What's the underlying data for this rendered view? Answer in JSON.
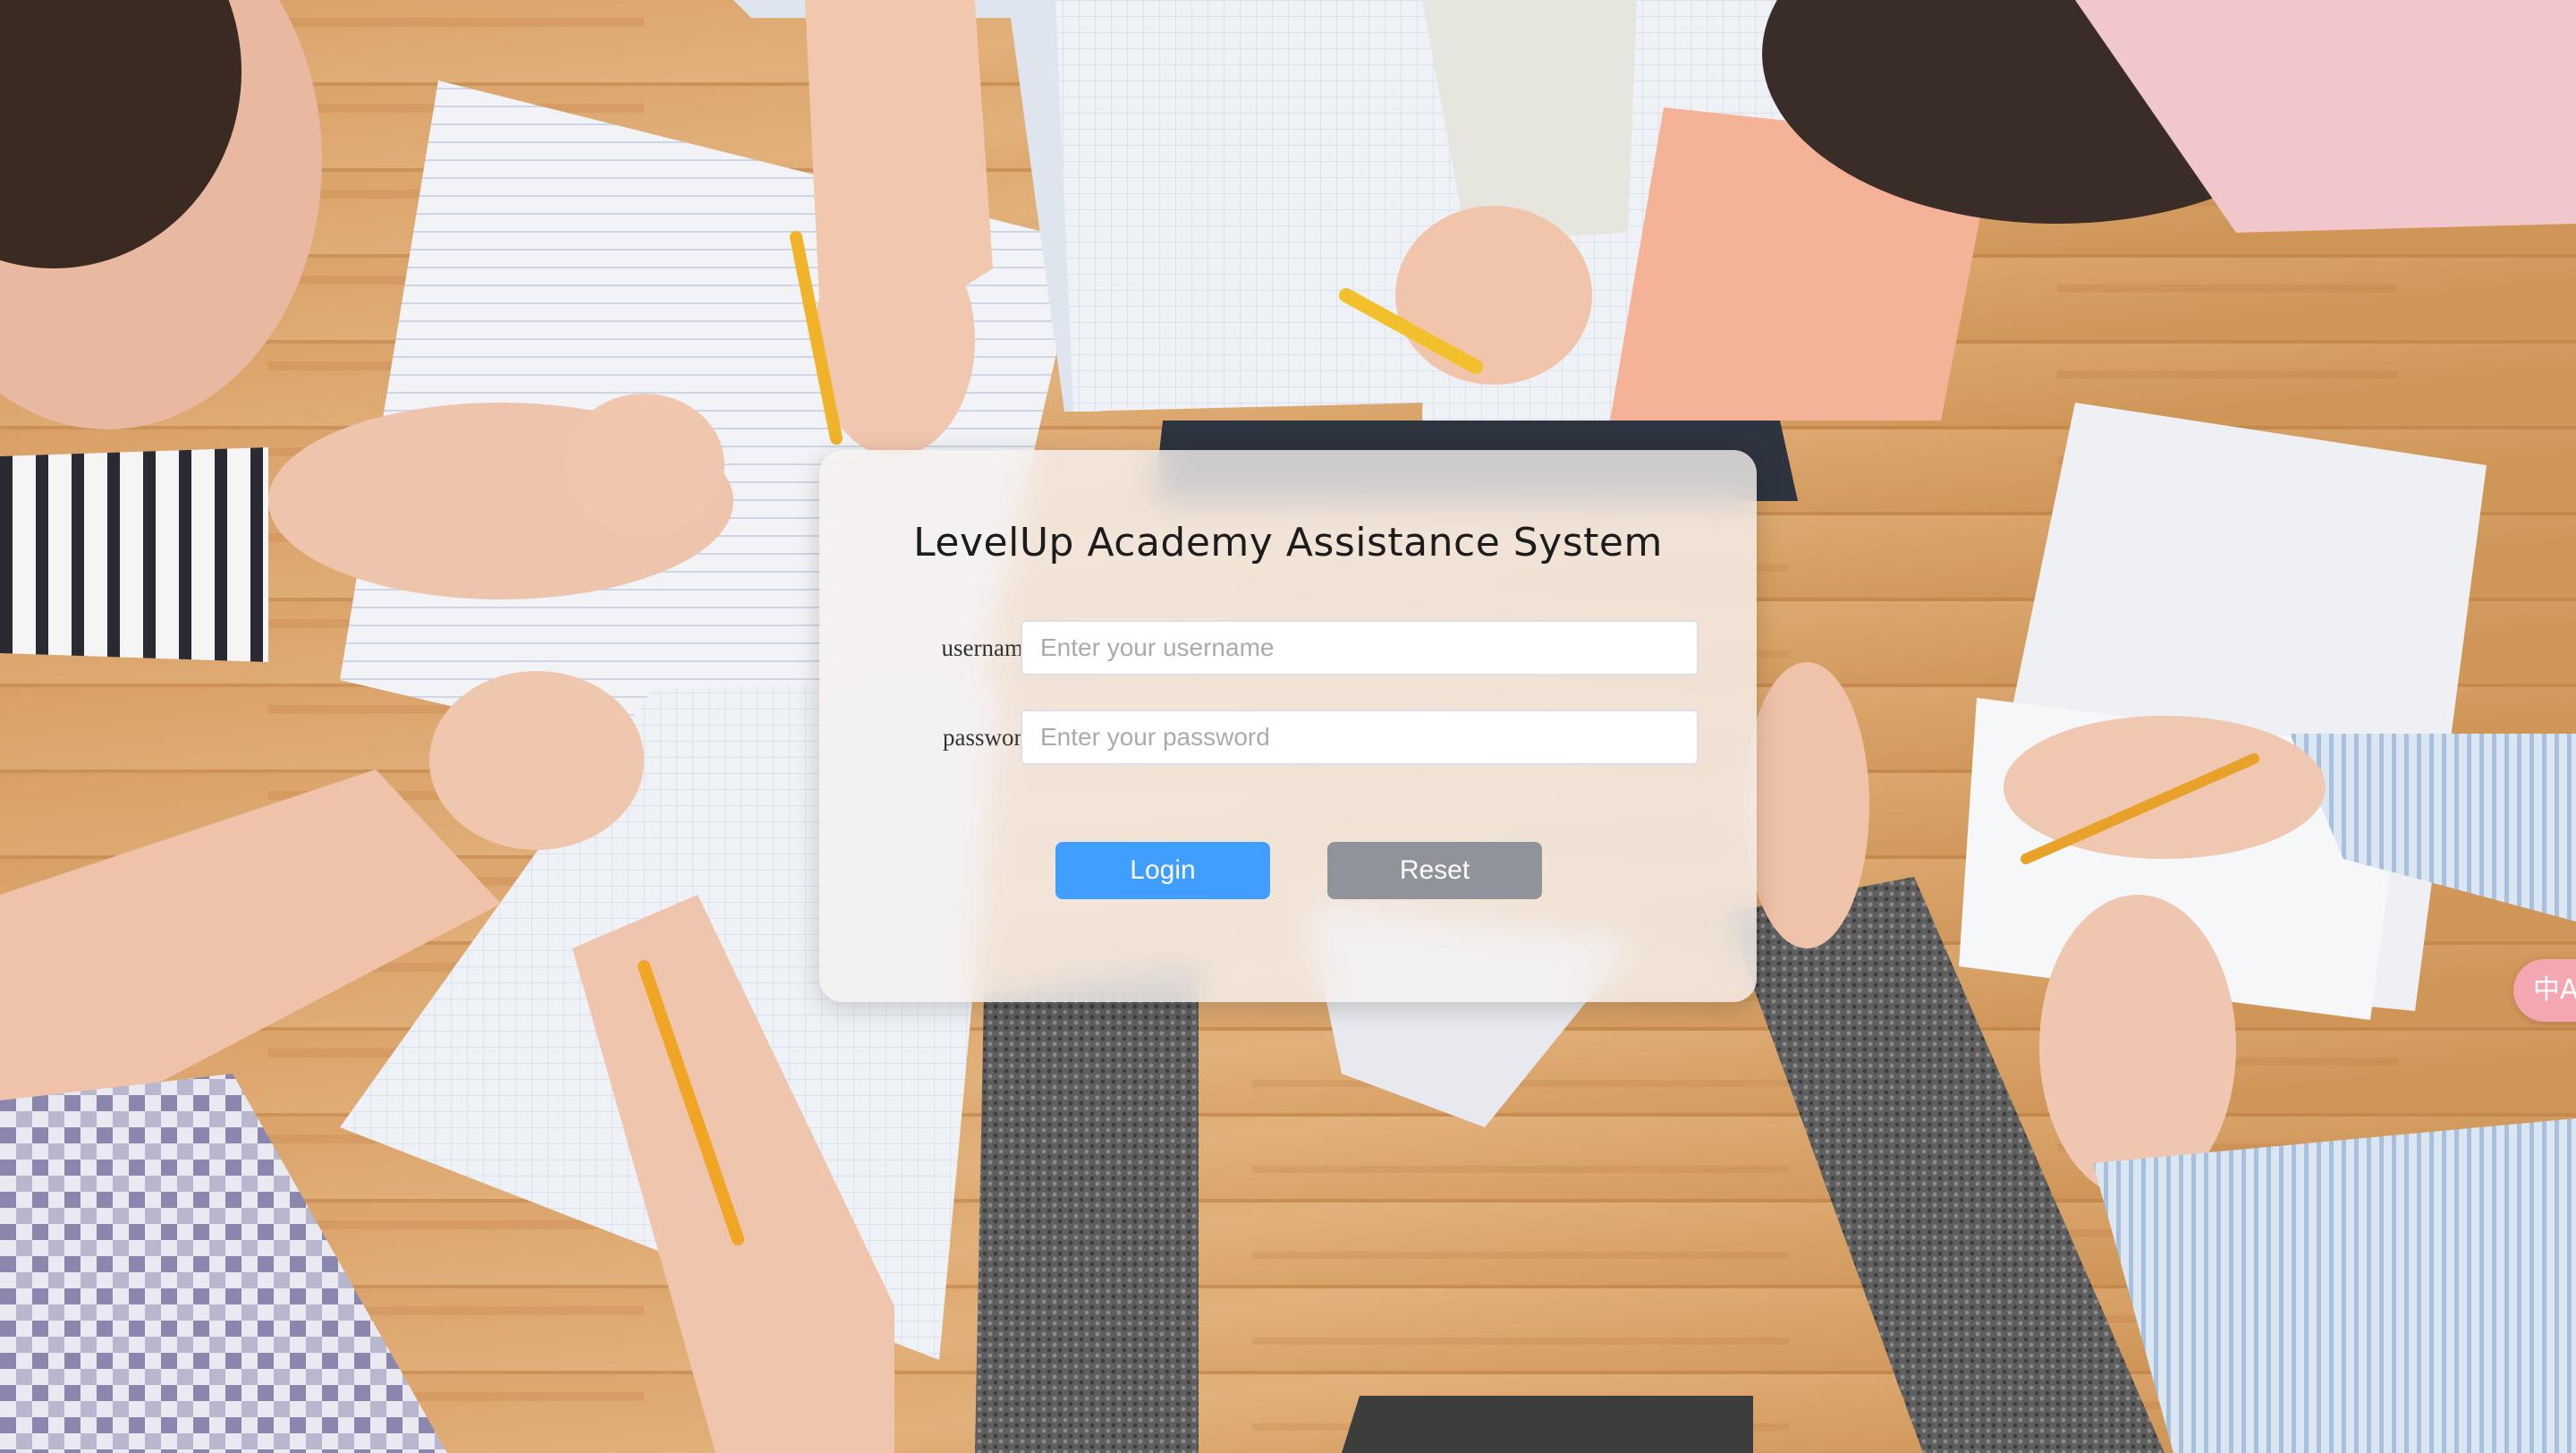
{
  "login": {
    "title": "LevelUp Academy Assistance System",
    "username_label": "username",
    "username_placeholder": "Enter your username",
    "password_label": "password",
    "password_placeholder": "Enter your password",
    "login_button": "Login",
    "reset_button": "Reset"
  },
  "translate_widget": {
    "icon": "translate-icon",
    "glyph": "中A"
  },
  "colors": {
    "primary": "#409eff",
    "secondary": "#909399"
  }
}
